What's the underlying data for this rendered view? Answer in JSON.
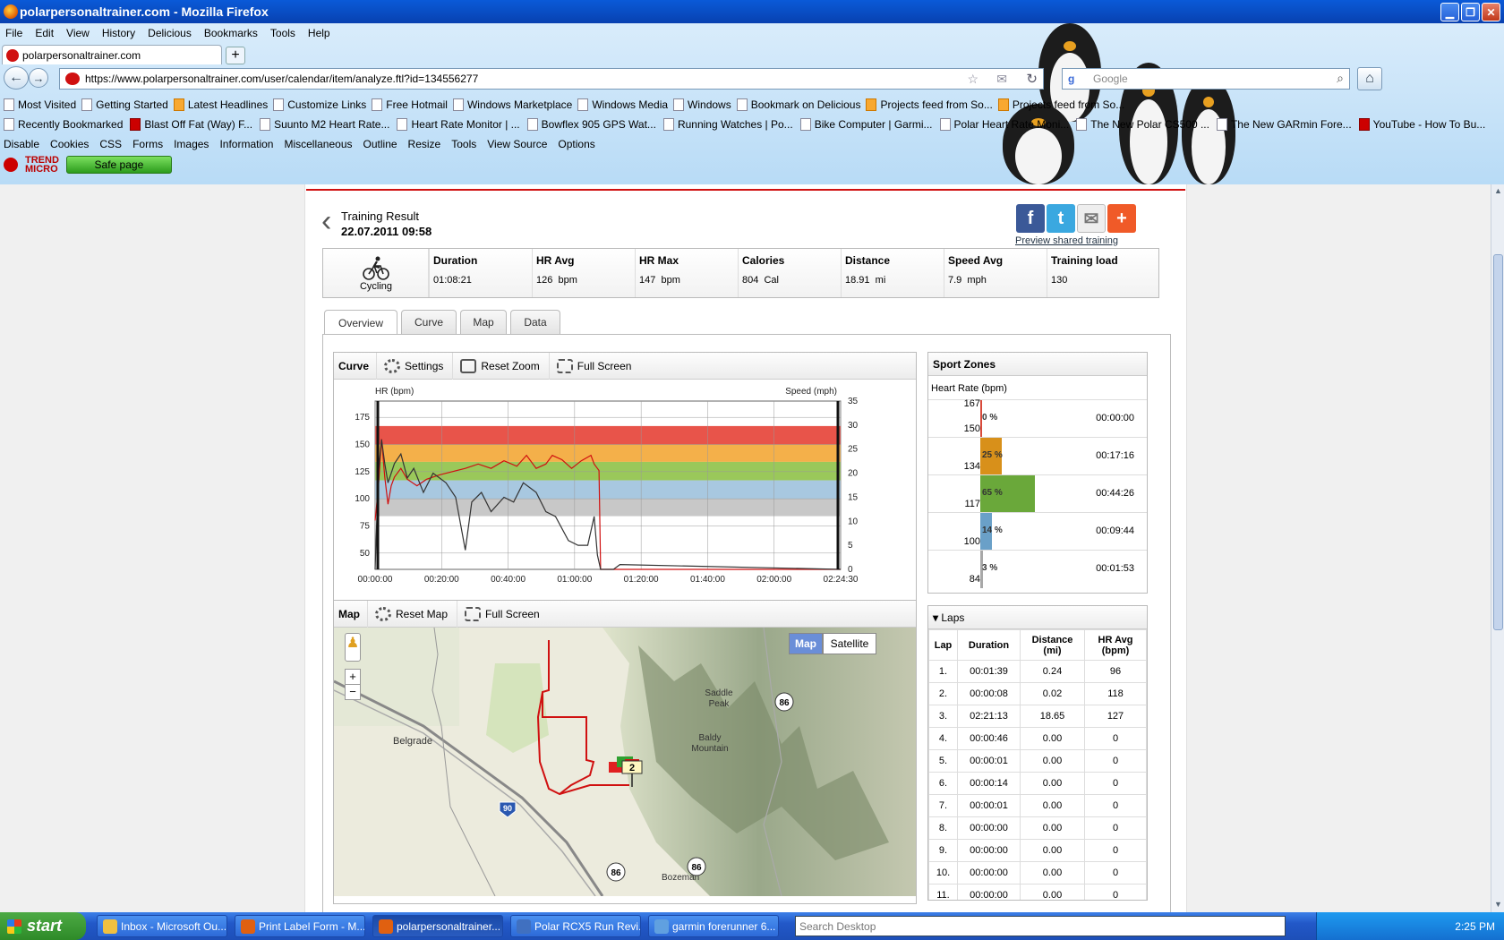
{
  "window": {
    "title": "polarpersonaltrainer.com - Mozilla Firefox"
  },
  "menu": [
    "File",
    "Edit",
    "View",
    "History",
    "Delicious",
    "Bookmarks",
    "Tools",
    "Help"
  ],
  "browser": {
    "tab_title": "polarpersonaltrainer.com",
    "url": "https://www.polarpersonaltrainer.com/user/calendar/item/analyze.ftl?id=134556277",
    "search_placeholder": "Google"
  },
  "bookmarks_row1": [
    "Most Visited",
    "Getting Started",
    "Latest Headlines",
    "Customize Links",
    "Free Hotmail",
    "Windows Marketplace",
    "Windows Media",
    "Windows",
    "Bookmark on Delicious",
    "Projects feed from So...",
    "Projects feed from So..."
  ],
  "bookmarks_row2": [
    "Recently Bookmarked",
    "Blast Off Fat (Way) F...",
    "Suunto M2 Heart Rate...",
    "Heart Rate Monitor | ...",
    "Bowflex 905 GPS Wat...",
    "Running Watches | Po...",
    "Bike Computer | Garmi...",
    "Polar Heart Rate Moni...",
    "The New Polar CS500 ...",
    "The New GARmin Fore...",
    "YouTube - How To Bu..."
  ],
  "devbar": [
    "Disable",
    "Cookies",
    "CSS",
    "Forms",
    "Images",
    "Information",
    "Miscellaneous",
    "Outline",
    "Resize",
    "Tools",
    "View Source",
    "Options"
  ],
  "trend": {
    "brand_top": "TREND",
    "brand_bottom": "MICRO",
    "safe_label": "Safe page"
  },
  "training": {
    "title": "Training Result",
    "datetime": "22.07.2011 09:58",
    "preview_link": "Preview shared training",
    "sport": "Cycling",
    "metrics": [
      {
        "label": "Duration",
        "value": "01:08:21",
        "unit": ""
      },
      {
        "label": "HR Avg",
        "value": "126",
        "unit": "bpm"
      },
      {
        "label": "HR Max",
        "value": "147",
        "unit": "bpm"
      },
      {
        "label": "Calories",
        "value": "804",
        "unit": "Cal"
      },
      {
        "label": "Distance",
        "value": "18.91",
        "unit": "mi"
      },
      {
        "label": "Speed Avg",
        "value": "7.9",
        "unit": "mph"
      },
      {
        "label": "Training load",
        "value": "130",
        "unit": ""
      }
    ]
  },
  "tabs": [
    "Overview",
    "Curve",
    "Map",
    "Data"
  ],
  "curve_panel": {
    "title": "Curve",
    "settings": "Settings",
    "reset_zoom": "Reset Zoom",
    "full_screen": "Full Screen"
  },
  "map_panel": {
    "title": "Map",
    "reset_map": "Reset Map",
    "full_screen": "Full Screen",
    "map_btn": "Map",
    "satellite_btn": "Satellite",
    "labels": {
      "belgrade": "Belgrade",
      "saddle_peak": "Saddle\nPeak",
      "baldy": "Baldy\nMountain",
      "bozeman": "Bozeman",
      "hw86": "86",
      "i90": "90",
      "marker": "2"
    }
  },
  "sport_zones": {
    "title": "Sport Zones",
    "subtitle": "Heart Rate (bpm)",
    "zones": [
      {
        "upper": "167",
        "lower": "150",
        "percent": "0 %",
        "duration": "00:00:00",
        "fraction": 0.0,
        "color": "#d84a3a"
      },
      {
        "upper": "",
        "lower": "134",
        "percent": "25 %",
        "duration": "00:17:16",
        "fraction": 0.25,
        "color": "#d8901a"
      },
      {
        "upper": "",
        "lower": "117",
        "percent": "65 %",
        "duration": "00:44:26",
        "fraction": 0.65,
        "color": "#6aa83a"
      },
      {
        "upper": "",
        "lower": "100",
        "percent": "14 %",
        "duration": "00:09:44",
        "fraction": 0.14,
        "color": "#6aa0c8"
      },
      {
        "upper": "",
        "lower": "84",
        "percent": "3 %",
        "duration": "00:01:53",
        "fraction": 0.03,
        "color": "#a8a8a8"
      }
    ]
  },
  "laps": {
    "title": "Laps",
    "headers": [
      "Lap",
      "Duration",
      "Distance\n(mi)",
      "HR Avg\n(bpm)"
    ],
    "rows": [
      [
        "1.",
        "00:01:39",
        "0.24",
        "96"
      ],
      [
        "2.",
        "00:00:08",
        "0.02",
        "118"
      ],
      [
        "3.",
        "02:21:13",
        "18.65",
        "127"
      ],
      [
        "4.",
        "00:00:46",
        "0.00",
        "0"
      ],
      [
        "5.",
        "00:00:01",
        "0.00",
        "0"
      ],
      [
        "6.",
        "00:00:14",
        "0.00",
        "0"
      ],
      [
        "7.",
        "00:00:01",
        "0.00",
        "0"
      ],
      [
        "8.",
        "00:00:00",
        "0.00",
        "0"
      ],
      [
        "9.",
        "00:00:00",
        "0.00",
        "0"
      ],
      [
        "10.",
        "00:00:00",
        "0.00",
        "0"
      ],
      [
        "11.",
        "00:00:00",
        "0.00",
        "0"
      ]
    ]
  },
  "chart_data": {
    "type": "line",
    "ylabel": "HR (bpm)",
    "y2label": "Speed (mph)",
    "x_ticks": [
      "00:00:00",
      "00:20:00",
      "00:40:00",
      "01:00:00",
      "01:20:00",
      "01:40:00",
      "02:00:00",
      "02:24:30"
    ],
    "y_ticks": [
      50,
      75,
      100,
      125,
      150,
      175
    ],
    "y2_ticks": [
      0,
      5,
      10,
      15,
      20,
      25,
      30,
      35
    ],
    "xlim_min": [
      0,
      144.5
    ],
    "ylim": [
      35,
      190
    ],
    "y2lim": [
      0,
      35
    ],
    "zones": [
      {
        "from": 150,
        "to": 167,
        "color": "#e8544a"
      },
      {
        "from": 134,
        "to": 150,
        "color": "#f4b04a"
      },
      {
        "from": 117,
        "to": 134,
        "color": "#9ac85a"
      },
      {
        "from": 100,
        "to": 117,
        "color": "#a8c8e0"
      },
      {
        "from": 84,
        "to": 100,
        "color": "#c8c8c8"
      }
    ],
    "series": [
      {
        "name": "HR",
        "color": "#d01010",
        "x": [
          0,
          1,
          2,
          3,
          4,
          5,
          6,
          8,
          10,
          13,
          16,
          20,
          24,
          28,
          32,
          36,
          40,
          44,
          47,
          50,
          53,
          55,
          58,
          61,
          64,
          67,
          68,
          69,
          69.5,
          70,
          144.5
        ],
        "y": [
          80,
          110,
          155,
          120,
          95,
          112,
          120,
          128,
          118,
          112,
          118,
          122,
          125,
          128,
          132,
          128,
          135,
          130,
          140,
          128,
          132,
          140,
          136,
          128,
          135,
          140,
          132,
          128,
          126,
          35,
          35
        ]
      },
      {
        "name": "Speed",
        "color": "#333333",
        "x": [
          0,
          1,
          2,
          3,
          4,
          5,
          6,
          8,
          10,
          12,
          15,
          18,
          22,
          25,
          28,
          30,
          33,
          36,
          40,
          43,
          46,
          50,
          53,
          56,
          60,
          63,
          66,
          68,
          69,
          70,
          74,
          76,
          144.5
        ],
        "y": [
          0,
          20,
          27,
          22,
          18,
          20,
          22,
          24,
          19,
          21,
          16,
          20,
          18,
          15,
          4,
          14,
          16,
          12,
          15,
          14,
          18,
          16,
          12,
          11,
          6,
          5,
          5,
          11,
          3,
          0,
          0,
          1,
          0
        ]
      }
    ]
  },
  "taskbar": {
    "start": "start",
    "tasks": [
      "Inbox - Microsoft Ou...",
      "Print Label Form - M...",
      "polarpersonaltrainer...",
      "Polar RCX5 Run Revi...",
      "garmin forerunner 6..."
    ],
    "search": "Search Desktop",
    "time": "2:25 PM"
  }
}
